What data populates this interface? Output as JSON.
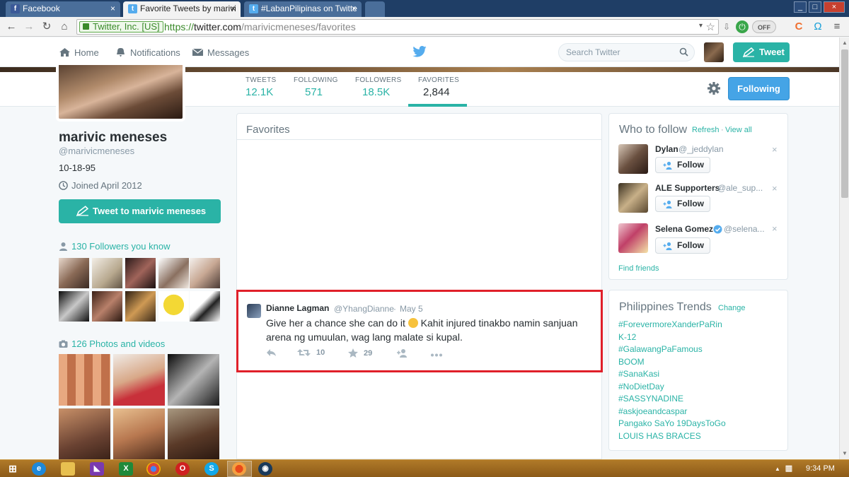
{
  "browser": {
    "tabs": [
      {
        "label": "Facebook",
        "favicon": "facebook-icon",
        "color": "#3b5998",
        "active": false
      },
      {
        "label": "Favorite Tweets by marivi",
        "favicon": "twitter-icon",
        "color": "#55acee",
        "active": true
      },
      {
        "label": "#LabanPilipinas on Twitte",
        "favicon": "twitter-icon",
        "color": "#55acee",
        "active": false
      }
    ],
    "ev_label": "Twitter, Inc. [US]",
    "url_scheme": "https://",
    "url_host": "twitter.com",
    "url_path": "/marivicmeneses/favorites",
    "toggle_label": "OFF"
  },
  "topbar": {
    "home": "Home",
    "notifications": "Notifications",
    "messages": "Messages",
    "search_placeholder": "Search Twitter",
    "tweet_button": "Tweet"
  },
  "stats": [
    {
      "label": "TWEETS",
      "value": "12.1K"
    },
    {
      "label": "FOLLOWING",
      "value": "571"
    },
    {
      "label": "FOLLOWERS",
      "value": "18.5K"
    },
    {
      "label": "FAVORITES",
      "value": "2,844"
    }
  ],
  "following_button": "Following",
  "profile": {
    "name": "marivic meneses",
    "handle": "@marivicmeneses",
    "bio": "10-18-95",
    "joined": "Joined April 2012",
    "tweet_to": "Tweet to marivic meneses",
    "followers_you_know": "130 Followers you know",
    "photos_videos": "126 Photos and videos"
  },
  "favorites": {
    "heading": "Favorites",
    "tweet": {
      "author": "Dianne Lagman",
      "handle": "@YhangDianne",
      "separator": "·",
      "date": "May 5",
      "text_before_emoji": "Give her a chance she can do it ",
      "text_after_emoji": " Kahit injured tinakbo namin sanjuan arena ng umuulan, wag lang malate si kupal.",
      "retweets": "10",
      "favorites": "29"
    }
  },
  "who_to_follow": {
    "title": "Who to follow",
    "refresh": "Refresh",
    "dot": "·",
    "view_all": "View all",
    "follow_label": "Follow",
    "dismiss": "×",
    "suggestions": [
      {
        "name": "Dylan",
        "handle": "@_jeddylan"
      },
      {
        "name": "ALE Supporters",
        "handle": "@ale_sup..."
      },
      {
        "name": "Selena Gomez",
        "handle": "@selena..."
      }
    ],
    "find_friends": "Find friends"
  },
  "trends": {
    "title": "Philippines Trends",
    "change": "Change",
    "items": [
      "#ForevermoreXanderPaRin",
      "K-12",
      "#GalawangPaFamous",
      "BOOM",
      "#SanaKasi",
      "#NoDietDay",
      "#SASSYNADINE",
      "#askjoeandcaspar",
      "Pangako SaYo 19DaysToGo",
      "LOUIS HAS BRACES"
    ]
  },
  "taskbar": {
    "clock": "9:34 PM"
  }
}
